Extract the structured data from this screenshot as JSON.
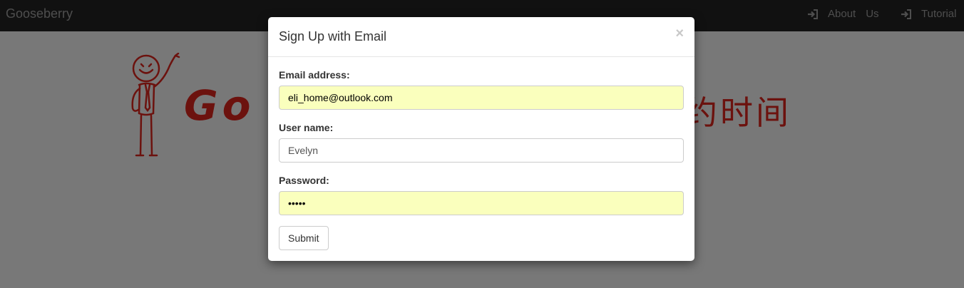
{
  "navbar": {
    "brand": "Gooseberry",
    "about_word1": "About",
    "about_word2": "Us",
    "tutorial": "Tutorial",
    "login_icon": "sign-in-icon"
  },
  "hero": {
    "logo_left": "Go",
    "logo_right": "约时间"
  },
  "modal": {
    "title": "Sign Up with Email",
    "close": "×",
    "email_label": "Email address:",
    "email_value": "eli_home@outlook.com",
    "username_label": "User name:",
    "username_value": "Evelyn",
    "password_label": "Password:",
    "password_value": "12345",
    "submit": "Submit"
  },
  "colors": {
    "navbar": "#222222",
    "autofill": "#faffbd",
    "logo_red": "#d9241c"
  }
}
